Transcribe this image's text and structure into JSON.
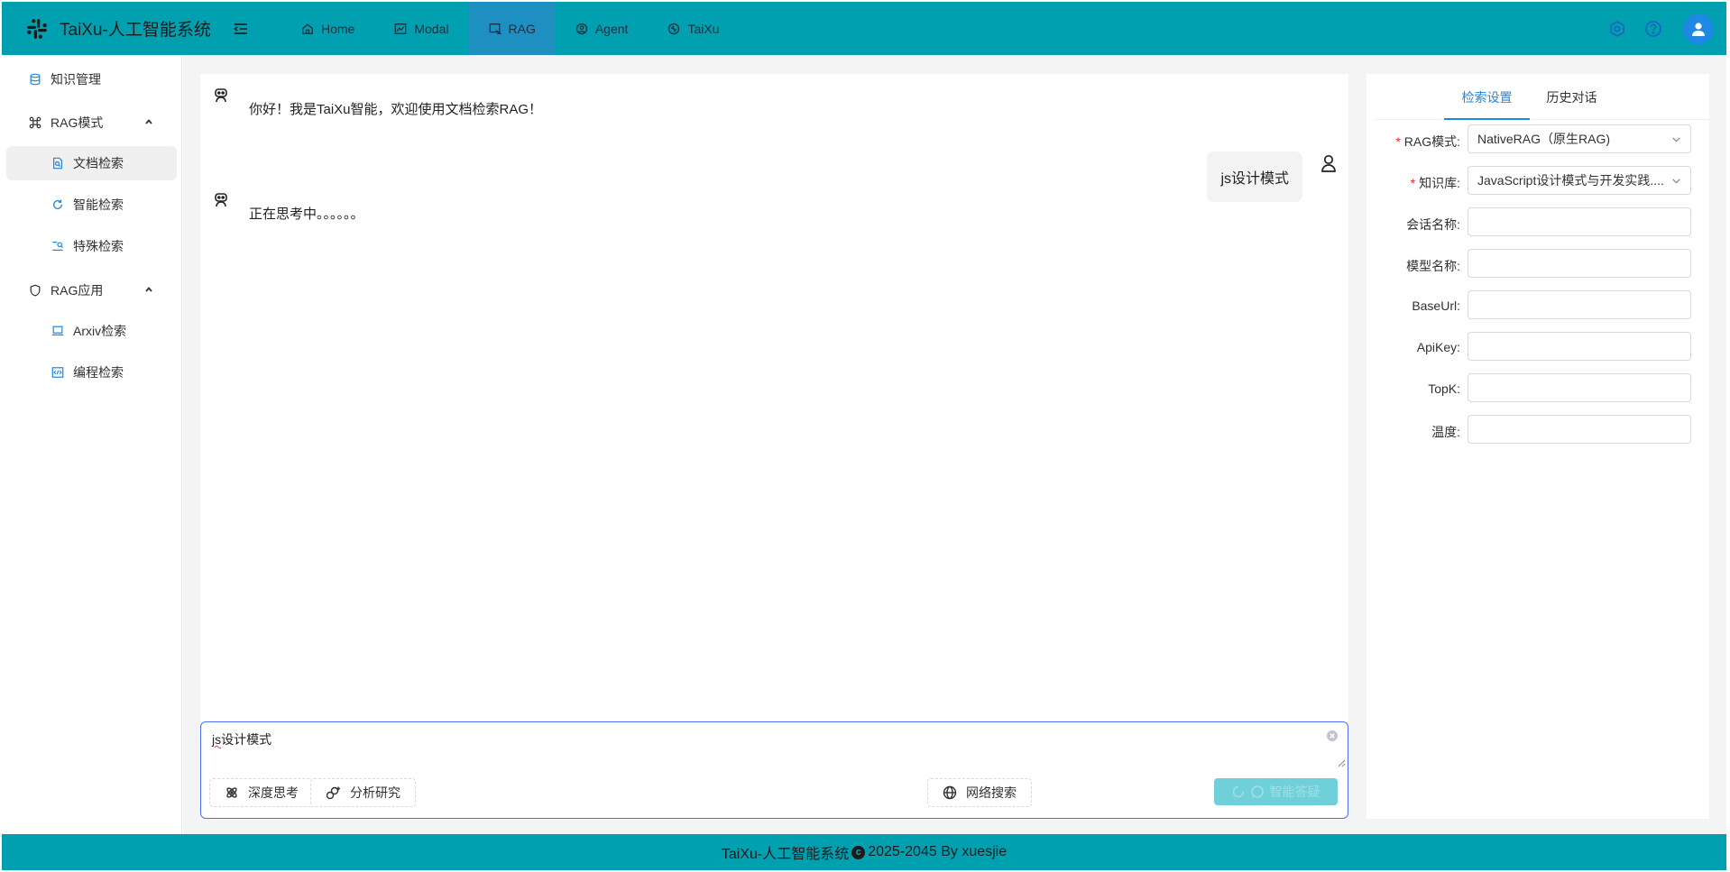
{
  "app": {
    "title": "TaiXu-人工智能系统"
  },
  "top_nav": [
    {
      "label": "Home",
      "icon": "home-icon"
    },
    {
      "label": "Modal",
      "icon": "image-chart-icon"
    },
    {
      "label": "RAG",
      "icon": "rag-icon",
      "active": true
    },
    {
      "label": "Agent",
      "icon": "agent-icon"
    },
    {
      "label": "TaiXu",
      "icon": "taixu-icon"
    }
  ],
  "sidebar": {
    "top_item": {
      "label": "知识管理",
      "icon": "database-icon"
    },
    "groups": [
      {
        "label": "RAG模式",
        "icon": "command-icon",
        "items": [
          {
            "label": "文档检索",
            "icon": "document-search-icon",
            "active": true
          },
          {
            "label": "智能检索",
            "icon": "refresh-icon"
          },
          {
            "label": "特殊检索",
            "icon": "search-list-icon"
          }
        ]
      },
      {
        "label": "RAG应用",
        "icon": "shield-icon",
        "items": [
          {
            "label": "Arxiv检索",
            "icon": "laptop-icon"
          },
          {
            "label": "编程检索",
            "icon": "code-icon"
          }
        ]
      }
    ]
  },
  "chat": {
    "welcome": "你好！我是TaiXu智能，欢迎使用文档检索RAG！",
    "user_message": "js设计模式",
    "thinking": "正在思考中。。。。。。",
    "input_value_part1": "js",
    "input_value_part2": "设计模式",
    "chips": {
      "deep_think": "深度思考",
      "analysis": "分析研究",
      "web_search": "网络搜索"
    },
    "send_label": "智能答疑"
  },
  "settings": {
    "tabs": [
      "检索设置",
      "历史对话"
    ],
    "active_tab": 0,
    "fields": {
      "rag_mode": {
        "label": "RAG模式:",
        "value": "NativeRAG（原生RAG)",
        "required": true
      },
      "knowledge": {
        "label": "知识库:",
        "value": "JavaScript设计模式与开发实践....",
        "required": true
      },
      "session": {
        "label": "会话名称:",
        "value": ""
      },
      "model": {
        "label": "模型名称:",
        "value": ""
      },
      "base_url": {
        "label": "BaseUrl:",
        "value": ""
      },
      "api_key": {
        "label": "ApiKey:",
        "value": ""
      },
      "topk": {
        "label": "TopK:",
        "value": ""
      },
      "temperature": {
        "label": "温度:",
        "value": ""
      }
    }
  },
  "footer": {
    "before": "TaiXu-人工智能系统",
    "copy_symbol": "c",
    "after": "2025-2045 By xuesjie"
  },
  "colors": {
    "header": "#00a0b0",
    "accent": "#1e88e5",
    "active_nav": "#1d8fc0",
    "send_button": "#6fd0d9"
  }
}
